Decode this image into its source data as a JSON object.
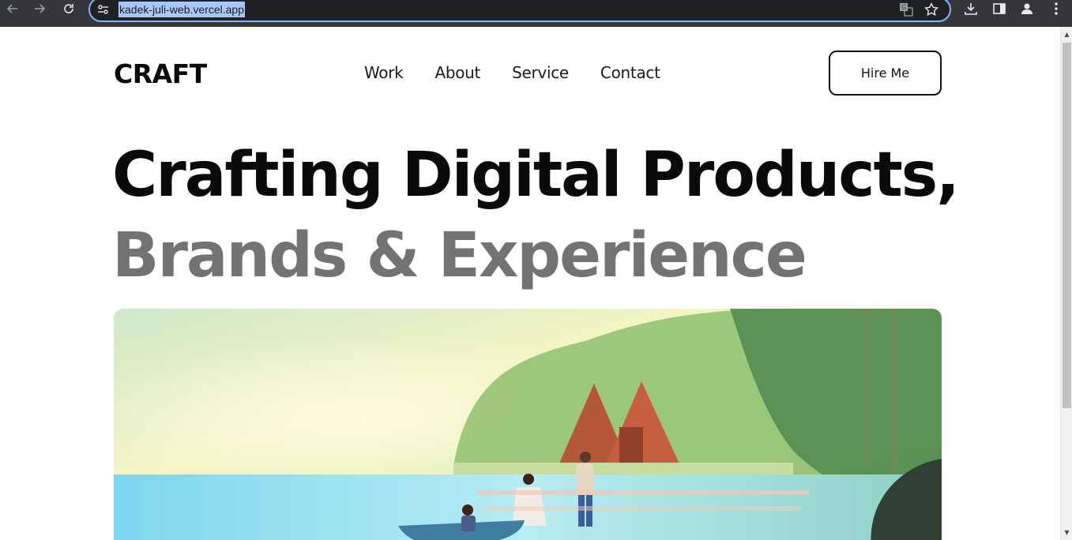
{
  "browser": {
    "url": "kadek-juli-web.vercel.app",
    "icons": {
      "back": "back-arrow-icon",
      "forward": "forward-arrow-icon",
      "reload": "reload-icon",
      "site_info": "site-settings-icon",
      "translate": "translate-icon",
      "bookmark": "star-icon",
      "downloads": "download-icon",
      "side_panel": "side-panel-icon",
      "profile": "profile-icon",
      "menu": "kebab-menu-icon"
    }
  },
  "site": {
    "logo": "CRAFT",
    "nav": [
      {
        "label": "Work"
      },
      {
        "label": "About"
      },
      {
        "label": "Service"
      },
      {
        "label": "Contact"
      }
    ],
    "cta": "Hire Me",
    "headline_line1": "Crafting Digital Products,",
    "headline_line2": "Brands & Experience",
    "hero_image": "illustration of lakeside cabins with people and a boat"
  },
  "colors": {
    "headline_dark": "#0a0a0a",
    "headline_gray": "#737373",
    "url_highlight": "#a8c7fa",
    "omnibox_border": "#8ab4f8",
    "chrome_bg": "#35363a"
  },
  "scrollbar": {
    "scroll_fraction": 0
  }
}
